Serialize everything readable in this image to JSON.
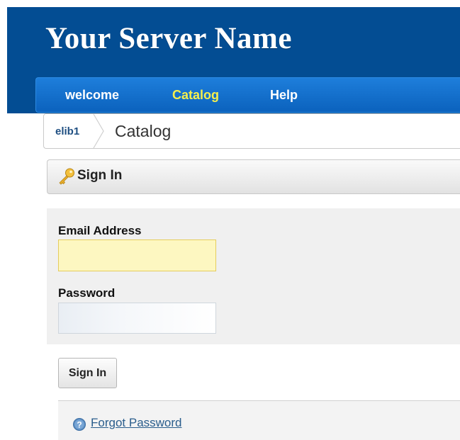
{
  "header": {
    "server_name": "Your Server Name"
  },
  "nav": {
    "items": [
      {
        "label": "welcome",
        "active": false
      },
      {
        "label": "Catalog",
        "active": true
      },
      {
        "label": "Help",
        "active": false
      }
    ]
  },
  "breadcrumb": {
    "link": "elib1",
    "current": "Catalog"
  },
  "signin_panel": {
    "title": "Sign In",
    "icon": "key-icon"
  },
  "form": {
    "email_label": "Email Address",
    "email_value": "",
    "password_label": "Password",
    "password_value": "",
    "submit_label": "Sign In"
  },
  "footer": {
    "forgot_password": "Forgot Password",
    "icon": "help-icon"
  },
  "colors": {
    "header_bg": "#034d93",
    "nav_active": "#f6ef4c",
    "email_field_bg": "#fdf7c1",
    "link": "#2a5d8c"
  }
}
